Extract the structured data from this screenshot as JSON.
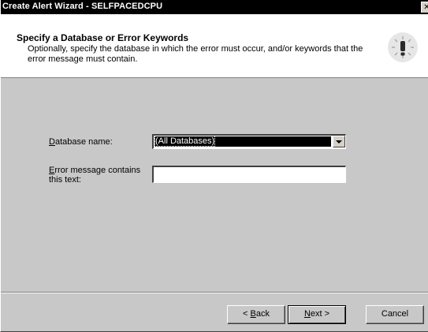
{
  "window": {
    "title": "Create Alert Wizard - SELFPACEDCPU",
    "close_glyph": "✕"
  },
  "header": {
    "heading": "Specify a Database or Error Keywords",
    "description": "Optionally, specify the database in which the error must occur, and/or keywords that the error message must contain.",
    "icon": "alert-wizard-icon"
  },
  "form": {
    "database_label_key": "D",
    "database_label_rest": "atabase name:",
    "database_value": "(All Databases)",
    "error_label_key": "E",
    "error_label_rest": "rror message contains this text:",
    "error_value": ""
  },
  "buttons": {
    "back_prefix": "< ",
    "back_key": "B",
    "back_rest": "ack",
    "next_key": "N",
    "next_rest": "ext >",
    "cancel": "Cancel"
  },
  "colors": {
    "titlebar": "#000000",
    "dialog_bg": "#c8c8c8",
    "header_bg": "#ffffff",
    "selection": "#000000"
  }
}
